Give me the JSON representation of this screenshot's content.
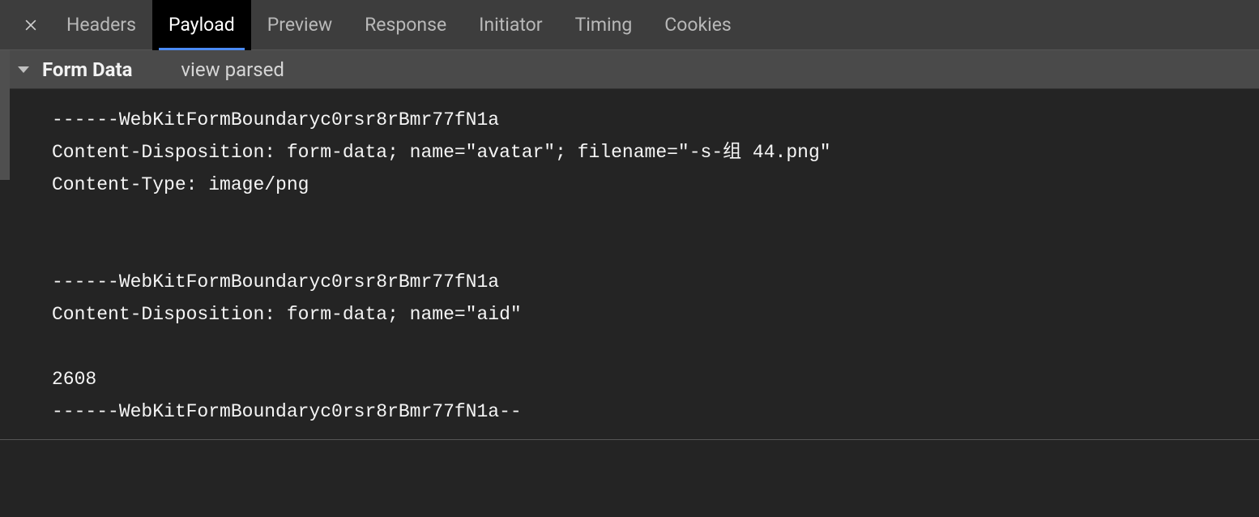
{
  "tabs": {
    "items": [
      {
        "label": "Headers"
      },
      {
        "label": "Payload"
      },
      {
        "label": "Preview"
      },
      {
        "label": "Response"
      },
      {
        "label": "Initiator"
      },
      {
        "label": "Timing"
      },
      {
        "label": "Cookies"
      }
    ],
    "activeIndex": 1
  },
  "section": {
    "title": "Form Data",
    "viewToggle": "view parsed"
  },
  "payload": {
    "lines": [
      "------WebKitFormBoundaryc0rsr8rBmr77fN1a",
      "Content-Disposition: form-data; name=\"avatar\"; filename=\"-s-组 44.png\"",
      "Content-Type: image/png",
      "",
      "",
      "------WebKitFormBoundaryc0rsr8rBmr77fN1a",
      "Content-Disposition: form-data; name=\"aid\"",
      "",
      "2608",
      "------WebKitFormBoundaryc0rsr8rBmr77fN1a--"
    ]
  }
}
